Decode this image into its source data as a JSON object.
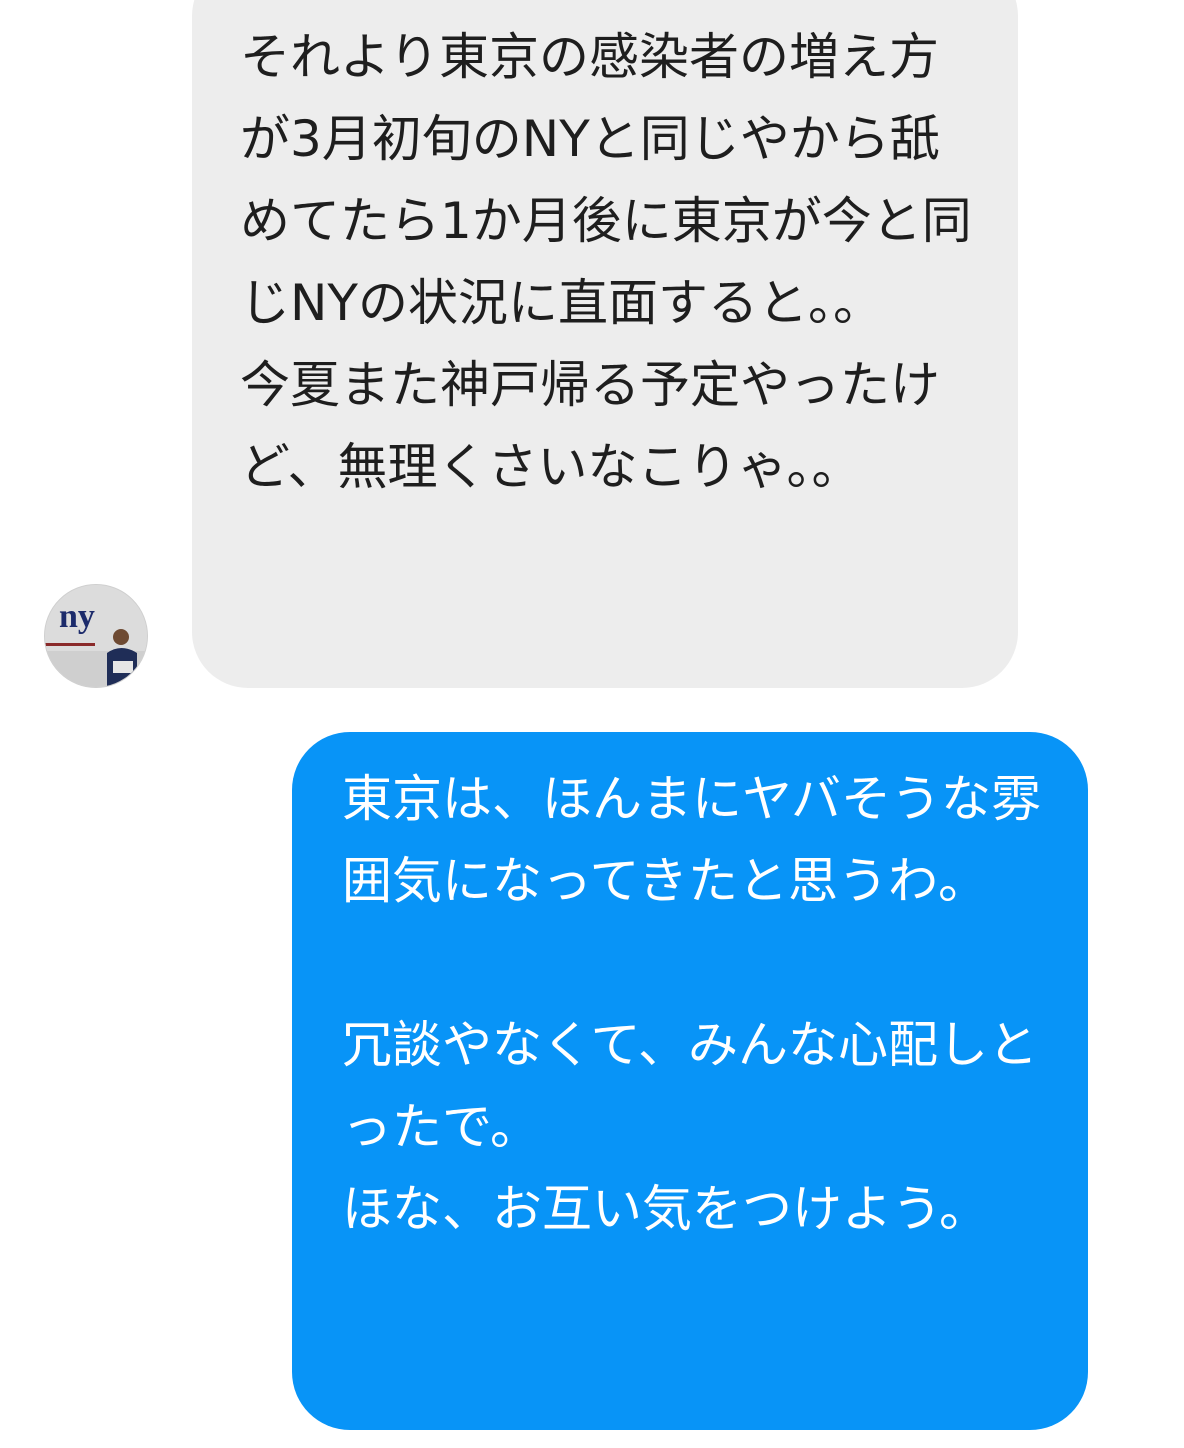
{
  "conversation": {
    "incoming": {
      "text": "それより東京の感染者の増え方が3月初旬のNYと同じやから舐めてたら1か月後に東京が今と同じNYの状況に直面すると。。\n今夏また神戸帰る予定やったけど、無理くさいなこりゃ。。"
    },
    "outgoing": {
      "text": "東京は、ほんまにヤバそうな雰囲気になってきたと思うわ。\n\n冗談やなくて、みんな心配しとったで。\nほな、お互い気をつけよう。"
    },
    "avatar": {
      "icon": "user-avatar-icon",
      "logo_text": "ny"
    }
  },
  "colors": {
    "incoming_bubble": "#ededed",
    "incoming_text": "#1e1e1e",
    "outgoing_bubble": "#0894f7",
    "outgoing_text": "#ffffff",
    "background": "#ffffff"
  }
}
